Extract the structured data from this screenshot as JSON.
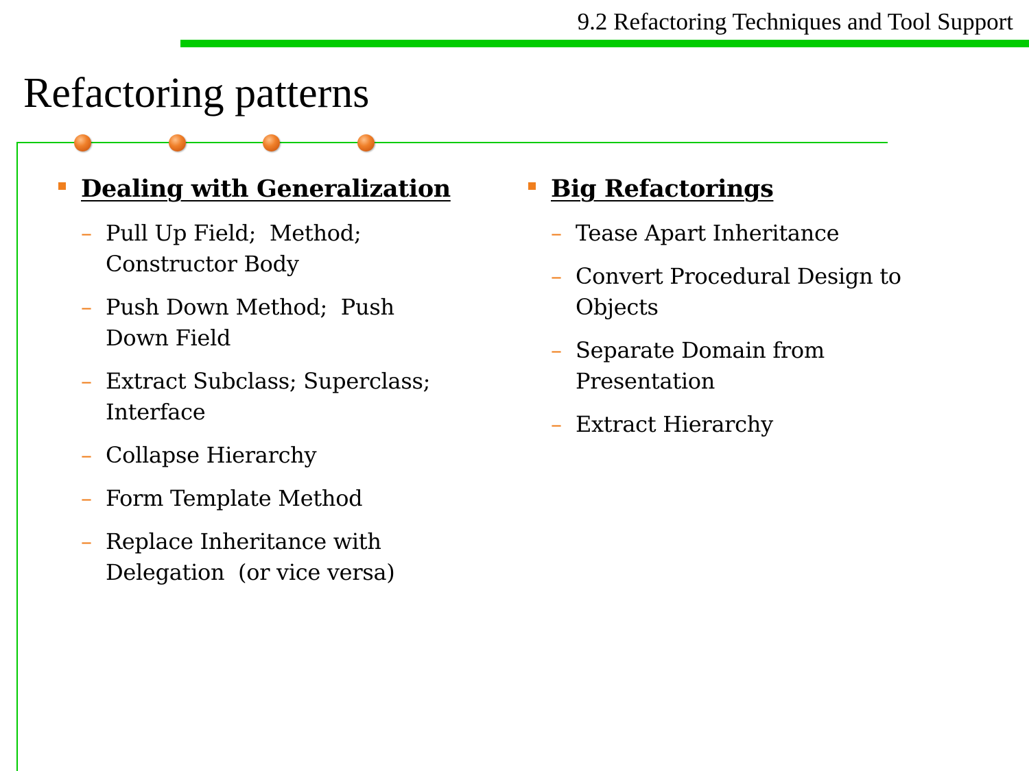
{
  "header": {
    "section_title": "9.2 Refactoring Techniques and Tool Support",
    "accent_color": "#00cc00"
  },
  "slide": {
    "title": "Refactoring patterns",
    "bullet_color": "#f07f1e"
  },
  "columns": [
    {
      "heading": "Dealing with Generalization",
      "items": [
        "Pull Up Field;  Method;\nConstructor Body",
        "Push Down Method;  Push\nDown Field",
        "Extract Subclass; Superclass;\nInterface",
        "Collapse Hierarchy",
        "Form Template Method",
        "Replace Inheritance with\nDelegation  (or vice versa)"
      ]
    },
    {
      "heading": "Big Refactorings",
      "items": [
        "Tease Apart Inheritance",
        "Convert Procedural Design to\nObjects",
        "Separate Domain from\nPresentation",
        "Extract Hierarchy"
      ]
    }
  ],
  "icons": {
    "decor_dot": "orange-sphere-icon",
    "bullet": "orange-square-icon",
    "sub_bullet": "dash-icon"
  }
}
